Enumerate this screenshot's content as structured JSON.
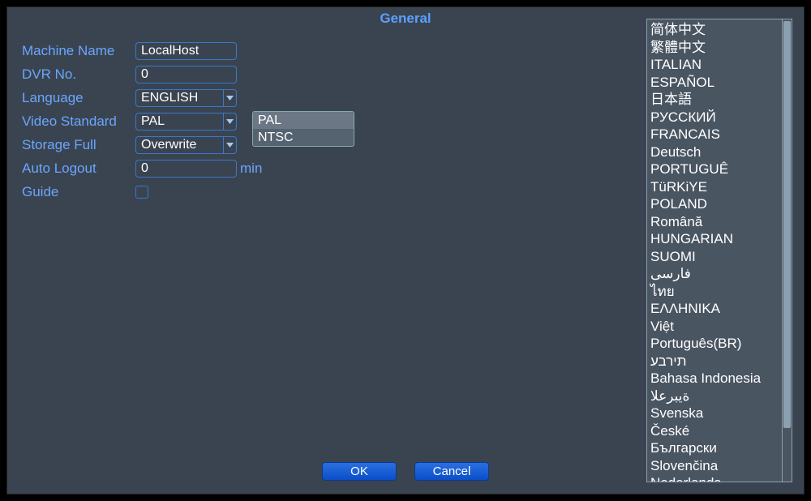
{
  "title": "General",
  "form": {
    "machine_name": {
      "label": "Machine Name",
      "value": "LocalHost"
    },
    "dvr_no": {
      "label": "DVR No.",
      "value": "0"
    },
    "language": {
      "label": "Language",
      "value": "ENGLISH"
    },
    "video_standard": {
      "label": "Video Standard",
      "value": "PAL"
    },
    "storage_full": {
      "label": "Storage Full",
      "value": "Overwrite"
    },
    "auto_logout": {
      "label": "Auto Logout",
      "value": "0",
      "unit": "min"
    },
    "guide": {
      "label": "Guide"
    }
  },
  "video_standard_options": [
    "PAL",
    "NTSC"
  ],
  "languages": [
    "简体中文",
    "繁體中文",
    "ITALIAN",
    "ESPAÑOL",
    "日本語",
    "РУССКИЙ",
    "FRANCAIS",
    "Deutsch",
    "PORTUGUÊ",
    "TüRKiYE",
    "POLAND",
    "Română",
    "HUNGARIAN",
    "SUOMI",
    "فارسی",
    "ไทย",
    "ΕΛΛΗΝΙΚΑ",
    "Việt",
    "Português(BR)",
    "תירבע",
    "Bahasa Indonesia",
    "ةيبرعلا",
    "Svenska",
    "České",
    "Български",
    "Slovenčina",
    "Nederlands"
  ],
  "buttons": {
    "ok": "OK",
    "cancel": "Cancel"
  }
}
